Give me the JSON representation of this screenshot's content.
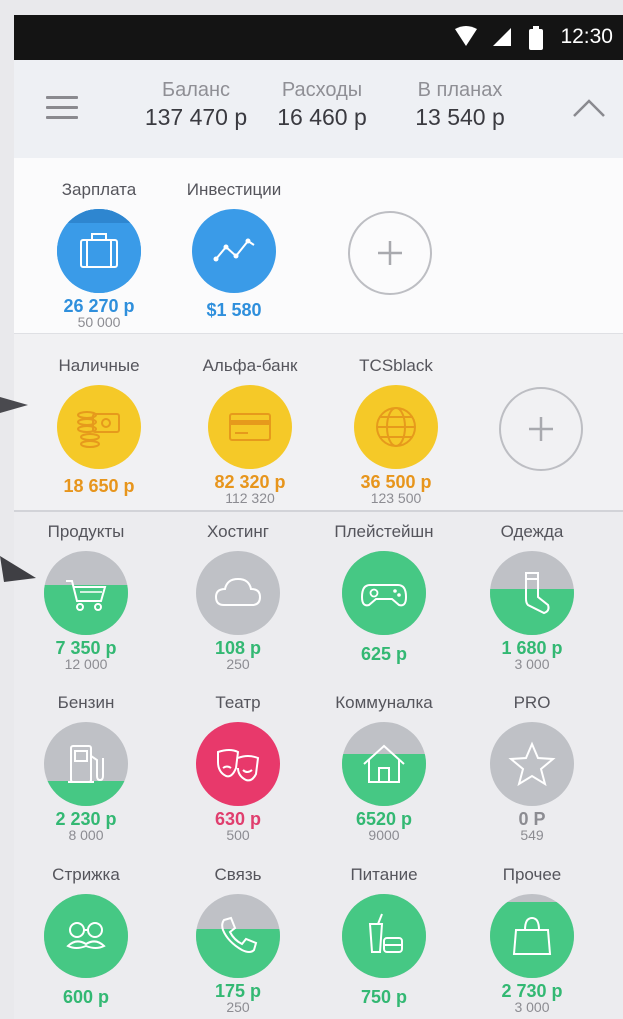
{
  "status_bar": {
    "time": "12:30"
  },
  "header": {
    "stats": [
      {
        "label": "Баланс",
        "value": "137 470 р"
      },
      {
        "label": "Расходы",
        "value": "16 460 р"
      },
      {
        "label": "В планах",
        "value": "13 540 р"
      }
    ]
  },
  "income": [
    {
      "name": "Зарплата",
      "amount": "26 270 р",
      "limit": "50 000",
      "icon": "briefcase-icon",
      "color": "#3a9be8"
    },
    {
      "name": "Инвестиции",
      "amount": "$1 580",
      "limit": "",
      "icon": "chart-line-icon",
      "color": "#3a9be8"
    }
  ],
  "accounts": [
    {
      "name": "Наличные",
      "amount": "18 650 р",
      "limit": "",
      "icon": "cash-icon",
      "color": "#f5c928"
    },
    {
      "name": "Альфа-банк",
      "amount": "82 320 р",
      "limit": "112 320",
      "icon": "credit-card-icon",
      "color": "#f5c928"
    },
    {
      "name": "TCSblack",
      "amount": "36 500 р",
      "limit": "123 500",
      "icon": "globe-icon",
      "color": "#f5c928"
    }
  ],
  "expenses": [
    {
      "name": "Продукты",
      "amount": "7 350 р",
      "limit": "12 000",
      "icon": "cart-icon",
      "fill": 0.6,
      "amount_color": "#33b873"
    },
    {
      "name": "Хостинг",
      "amount": "108 р",
      "limit": "250",
      "icon": "cloud-icon",
      "fill": 0,
      "amount_color": "#33b873"
    },
    {
      "name": "Плейстейшн",
      "amount": "625 р",
      "limit": "",
      "icon": "gamepad-icon",
      "fill": 1,
      "amount_color": "#33b873"
    },
    {
      "name": "Одежда",
      "amount": "1 680 р",
      "limit": "3 000",
      "icon": "sock-icon",
      "fill": 0.55,
      "amount_color": "#33b873"
    },
    {
      "name": "Бензин",
      "amount": "2 230 р",
      "limit": "8 000",
      "icon": "fuel-icon",
      "fill": 0.3,
      "amount_color": "#33b873"
    },
    {
      "name": "Театр",
      "amount": "630 р",
      "limit": "500",
      "icon": "theater-masks-icon",
      "fill": 1,
      "amount_color": "#e03e6e",
      "circle_color": "#e8396b"
    },
    {
      "name": "Коммуналка",
      "amount": "6520 р",
      "limit": "9000",
      "icon": "house-icon",
      "fill": 0.62,
      "amount_color": "#33b873"
    },
    {
      "name": "PRO",
      "amount": "0 Р",
      "limit": "549",
      "icon": "star-icon",
      "fill": 0,
      "amount_color": "#8c8c92"
    },
    {
      "name": "Стрижка",
      "amount": "600 р",
      "limit": "",
      "icon": "mustache-icon",
      "fill": 1,
      "amount_color": "#33b873"
    },
    {
      "name": "Связь",
      "amount": "175 р",
      "limit": "250",
      "icon": "phone-icon",
      "fill": 0.58,
      "amount_color": "#33b873"
    },
    {
      "name": "Питание",
      "amount": "750 р",
      "limit": "",
      "icon": "food-icon",
      "fill": 1,
      "amount_color": "#33b873"
    },
    {
      "name": "Прочее",
      "amount": "2 730 р",
      "limit": "3 000",
      "icon": "bag-icon",
      "fill": 0.9,
      "amount_color": "#33b873"
    }
  ]
}
